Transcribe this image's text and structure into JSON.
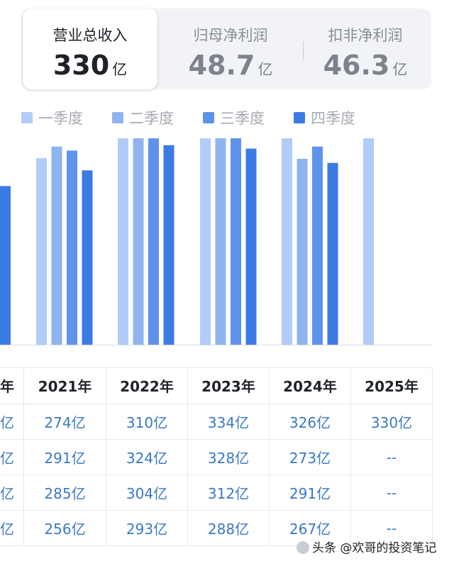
{
  "metrics": [
    {
      "name": "营业总收入",
      "value": "330",
      "unit": "亿",
      "active": true
    },
    {
      "name": "归母净利润",
      "value": "48.7",
      "unit": "亿",
      "active": false
    },
    {
      "name": "扣非净利润",
      "value": "46.3",
      "unit": "亿",
      "active": false
    }
  ],
  "colors": {
    "q1": "#b1cdf7",
    "q2": "#8fb4ef",
    "q3": "#5d93eb",
    "q4": "#3c7be3",
    "value_text": "#3a78c8"
  },
  "legend": [
    "一季度",
    "二季度",
    "三季度",
    "四季度"
  ],
  "chart_data": {
    "type": "bar",
    "categories": [
      "2021年",
      "2022年",
      "2023年",
      "2024年",
      "2025年"
    ],
    "series": [
      {
        "name": "一季度",
        "values": [
          274,
          310,
          334,
          326,
          330
        ]
      },
      {
        "name": "二季度",
        "values": [
          291,
          324,
          328,
          273,
          null
        ]
      },
      {
        "name": "三季度",
        "values": [
          285,
          304,
          312,
          291,
          null
        ]
      },
      {
        "name": "四季度",
        "values": [
          256,
          293,
          288,
          267,
          null
        ]
      }
    ],
    "partial_prior_year": {
      "q4": 233
    },
    "title": "",
    "xlabel": "",
    "ylabel": "",
    "ylim": [
      0,
      350
    ],
    "legend_position": "top-left",
    "grid": false
  },
  "table": {
    "partial_header": "年",
    "partial_values": [
      "亿",
      "亿",
      "亿",
      "亿"
    ],
    "columns": [
      "2021年",
      "2022年",
      "2023年",
      "2024年",
      "2025年"
    ],
    "rows": [
      [
        "274亿",
        "310亿",
        "334亿",
        "326亿",
        "330亿"
      ],
      [
        "291亿",
        "324亿",
        "328亿",
        "273亿",
        "--"
      ],
      [
        "285亿",
        "304亿",
        "312亿",
        "291亿",
        "--"
      ],
      [
        "256亿",
        "293亿",
        "288亿",
        "267亿",
        "--"
      ]
    ]
  },
  "watermark": "头条 @欢哥的投资笔记"
}
